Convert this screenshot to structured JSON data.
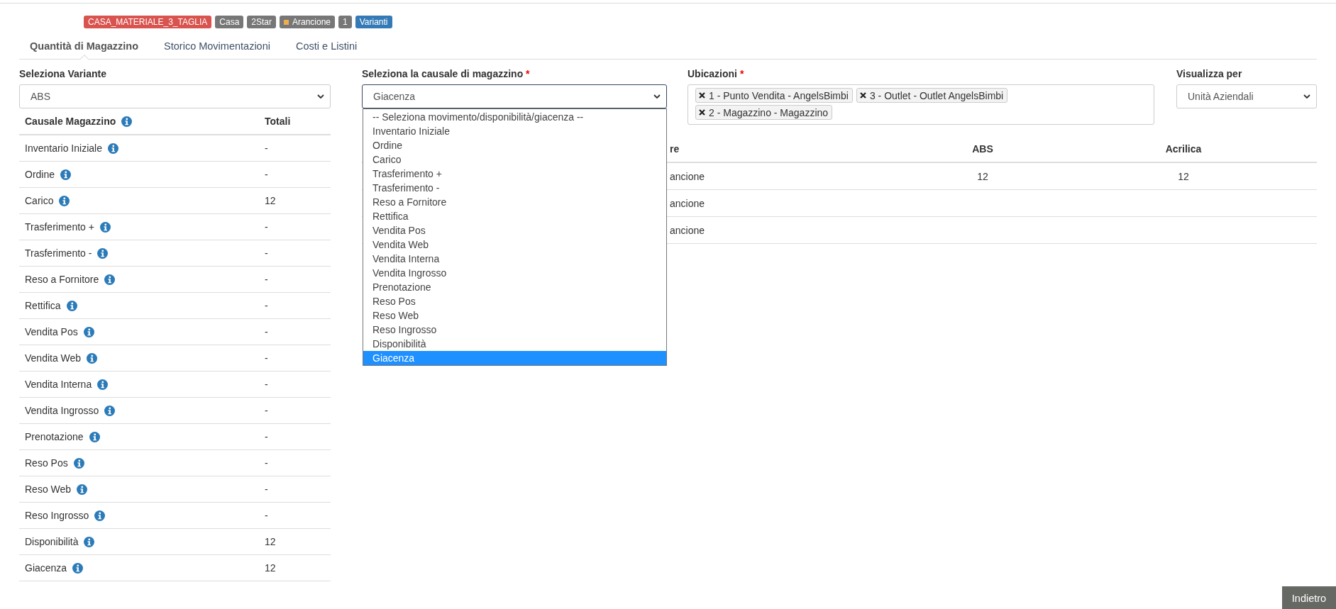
{
  "badges": [
    {
      "text": "CASA_MATERIALE_3_TAGLIA",
      "color": "#d9534f"
    },
    {
      "text": "Casa",
      "color": "#777777"
    },
    {
      "text": "2Star",
      "color": "#777777"
    },
    {
      "text": "Arancione",
      "color": "#777777",
      "dot": {
        "color": "#f0ad4e"
      }
    },
    {
      "text": "1",
      "color": "#777777"
    },
    {
      "text": "Varianti",
      "color": "#337ab7"
    }
  ],
  "tabs": [
    {
      "label": "Quantità di Magazzino",
      "selected": true
    },
    {
      "label": "Storico Movimentazioni",
      "selected": false
    },
    {
      "label": "Costi e Listini",
      "selected": false
    }
  ],
  "variant_select": {
    "label": "Seleziona Variante",
    "value": "ABS"
  },
  "totals_table": {
    "columns": [
      "Causale Magazzino",
      "Totali"
    ],
    "rows": [
      {
        "label": "Inventario Iniziale",
        "total": "-"
      },
      {
        "label": "Ordine",
        "total": "-"
      },
      {
        "label": "Carico",
        "total": "12"
      },
      {
        "label": "Trasferimento +",
        "total": "-"
      },
      {
        "label": "Trasferimento -",
        "total": "-"
      },
      {
        "label": "Reso a Fornitore",
        "total": "-"
      },
      {
        "label": "Rettifica",
        "total": "-"
      },
      {
        "label": "Vendita Pos",
        "total": "-"
      },
      {
        "label": "Vendita Web",
        "total": "-"
      },
      {
        "label": "Vendita Interna",
        "total": "-"
      },
      {
        "label": "Vendita Ingrosso",
        "total": "-"
      },
      {
        "label": "Prenotazione",
        "total": "-"
      },
      {
        "label": "Reso Pos",
        "total": "-"
      },
      {
        "label": "Reso Web",
        "total": "-"
      },
      {
        "label": "Reso Ingrosso",
        "total": "-"
      },
      {
        "label": "Disponibilità",
        "total": "12"
      },
      {
        "label": "Giacenza",
        "total": "12"
      }
    ]
  },
  "causal_select": {
    "label": "Seleziona la causale di magazzino",
    "required_mark": "*",
    "value": "Giacenza",
    "expanded": true,
    "options": [
      {
        "label": "-- Seleziona movimento/disponibilità/giacenza --",
        "selected": false
      },
      {
        "label": "Inventario Iniziale",
        "selected": false
      },
      {
        "label": "Ordine",
        "selected": false
      },
      {
        "label": "Carico",
        "selected": false
      },
      {
        "label": "Trasferimento +",
        "selected": false
      },
      {
        "label": "Trasferimento -",
        "selected": false
      },
      {
        "label": "Reso a Fornitore",
        "selected": false
      },
      {
        "label": "Rettifica",
        "selected": false
      },
      {
        "label": "Vendita Pos",
        "selected": false
      },
      {
        "label": "Vendita Web",
        "selected": false
      },
      {
        "label": "Vendita Interna",
        "selected": false
      },
      {
        "label": "Vendita Ingrosso",
        "selected": false
      },
      {
        "label": "Prenotazione",
        "selected": false
      },
      {
        "label": "Reso Pos",
        "selected": false
      },
      {
        "label": "Reso Web",
        "selected": false
      },
      {
        "label": "Reso Ingrosso",
        "selected": false
      },
      {
        "label": "Disponibilità",
        "selected": false
      },
      {
        "label": "Giacenza",
        "selected": true
      }
    ]
  },
  "locations": {
    "label": "Ubicazioni",
    "required_mark": "*",
    "tags": [
      "1 - Punto Vendita - AngelsBimbi",
      "3 - Outlet - Outlet AngelsBimbi",
      "2 - Magazzino - Magazzino"
    ]
  },
  "view_by": {
    "label": "Visualizza per",
    "value": "Unità Aziendali"
  },
  "stock_table": {
    "columns": [
      "re",
      "ABS",
      "Acrilica"
    ],
    "rows": [
      {
        "cells": [
          "ancione",
          "12",
          "12"
        ]
      },
      {
        "cells": [
          "ancione"
        ]
      },
      {
        "cells": [
          "ancione"
        ]
      }
    ]
  },
  "back_button": "Indietro"
}
